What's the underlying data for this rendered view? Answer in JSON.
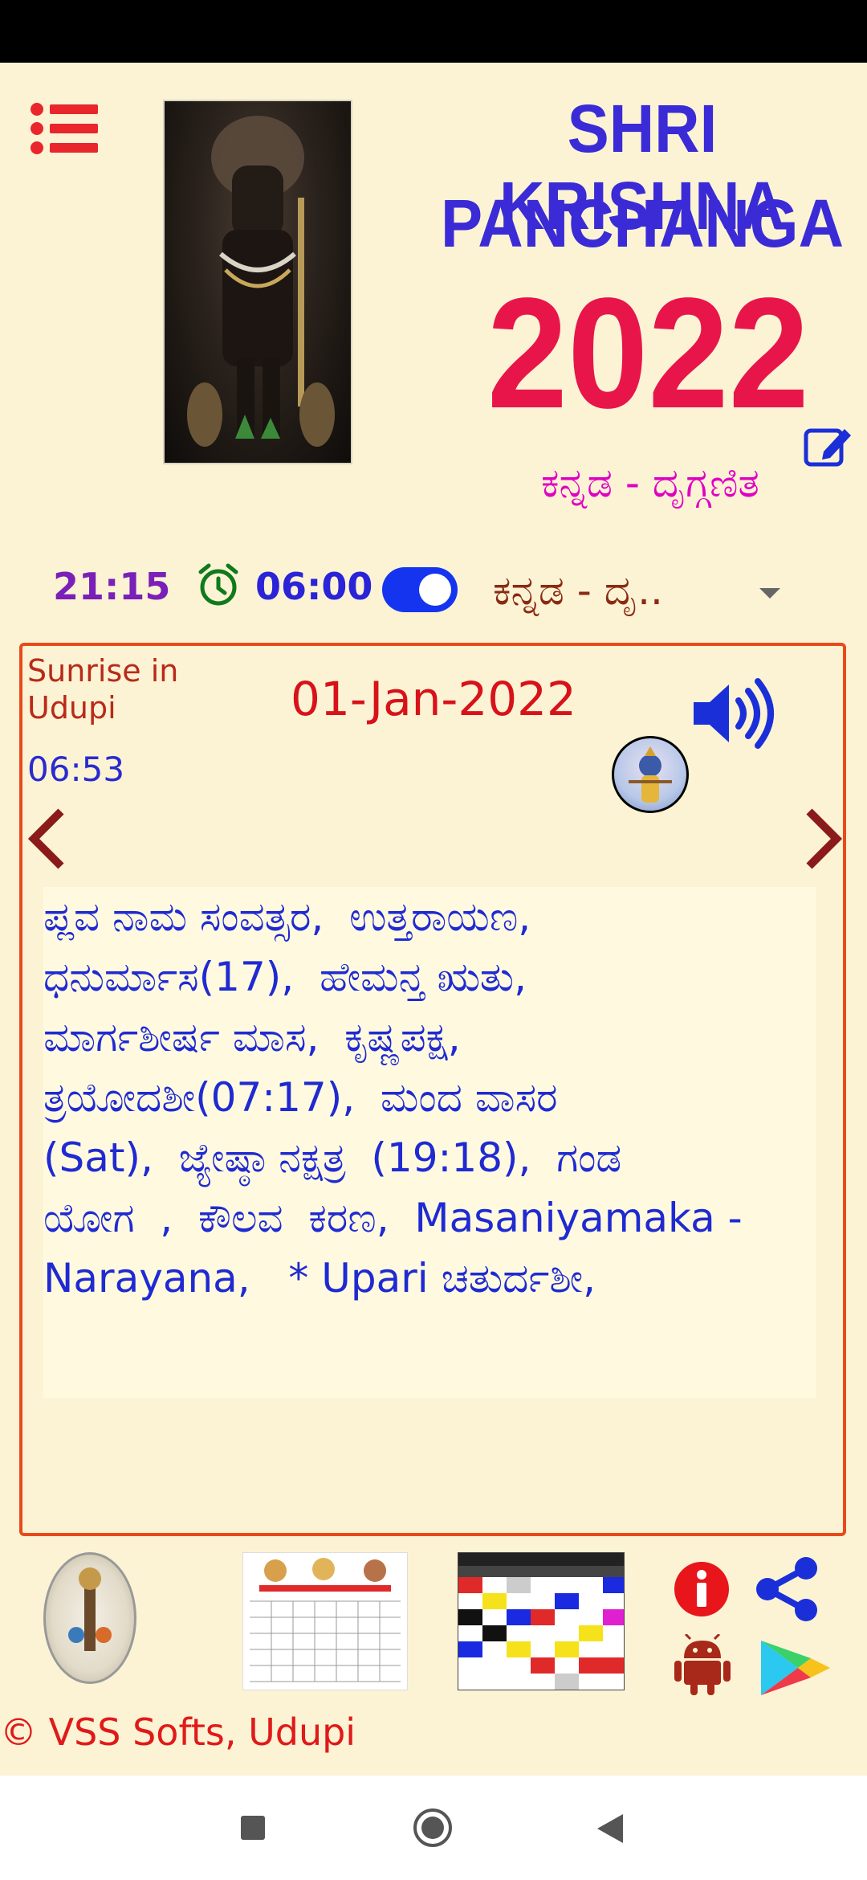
{
  "app": {
    "title_line1": "SHRI KRISHNA",
    "title_line2": "PANCHANGA",
    "year": "2022",
    "language_subtitle": "ಕನ್ನಡ - ದೃಗ್ಗಣಿತ"
  },
  "toolbar": {
    "current_time": "21:15",
    "alarm_time": "06:00",
    "alarm_enabled": true,
    "language_selected": "ಕನ್ನಡ - ದೃ.."
  },
  "panel": {
    "sunrise_label": "Sunrise in Udupi",
    "sunrise_time": "06:53",
    "date": "01-Jan-2022",
    "details": "ಪ್ಲವ ನಾಮ ಸಂವತ್ಸರ,  ಉತ್ತರಾಯಣ,\nಧನುರ್ಮಾಸ(17),  ಹೇಮನ್ತ ಋತು,\nಮಾರ್ಗಶೀರ್ಷ ಮಾಸ,  ಕೃಷ್ಣಪಕ್ಷ,\nತ್ರಯೋದಶೀ(07:17),  ಮಂದ ವಾಸರ\n(Sat),  ಜ್ಯೇಷ್ಠಾ ನಕ್ಷತ್ರ  (19:18),  ಗಂಡ\nಯೋಗ  ,  ಕೌಲವ  ಕರಣ,  Masaniyamaka -\nNarayana,   * Upari ಚತುರ್ದಶೀ,"
  },
  "footer": {
    "copyright": "© VSS Softs, Udupi"
  },
  "colors": {
    "background": "#fbf3d4",
    "title_blue": "#3a2bd6",
    "year_red": "#e8154a",
    "panel_border": "#e84a1c",
    "detail_text": "#1f2ad2"
  },
  "icons": {
    "menu": "menu-list-icon",
    "edit": "edit-icon",
    "alarm": "alarm-clock-icon",
    "speaker": "speaker-icon",
    "info": "info-icon",
    "share": "share-icon",
    "android": "android-icon",
    "play": "play-store-icon"
  }
}
